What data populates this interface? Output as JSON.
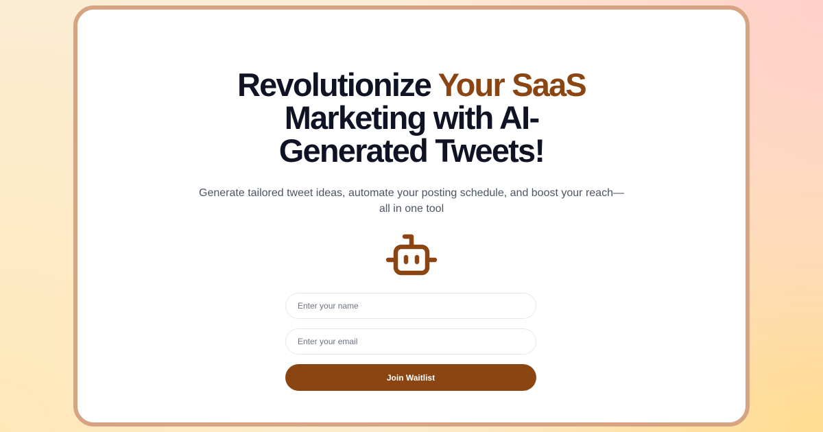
{
  "hero": {
    "title_line1_part1": "Revolutionize ",
    "title_line1_accent": "Your SaaS",
    "title_line2": "Marketing with AI-",
    "title_line3": "Generated Tweets!",
    "subtitle_line1": "Generate tailored tweet ideas, automate your posting schedule, and boost your reach—",
    "subtitle_line2": "all in one tool"
  },
  "icon": {
    "name": "robot-icon",
    "color": "#8b4513"
  },
  "form": {
    "name_placeholder": "Enter your name",
    "email_placeholder": "Enter your email",
    "submit_label": "Join Waitlist"
  },
  "colors": {
    "accent": "#8b4513",
    "card_border": "#d6a483",
    "heading": "#0f1324",
    "body_text": "#4b5563"
  }
}
